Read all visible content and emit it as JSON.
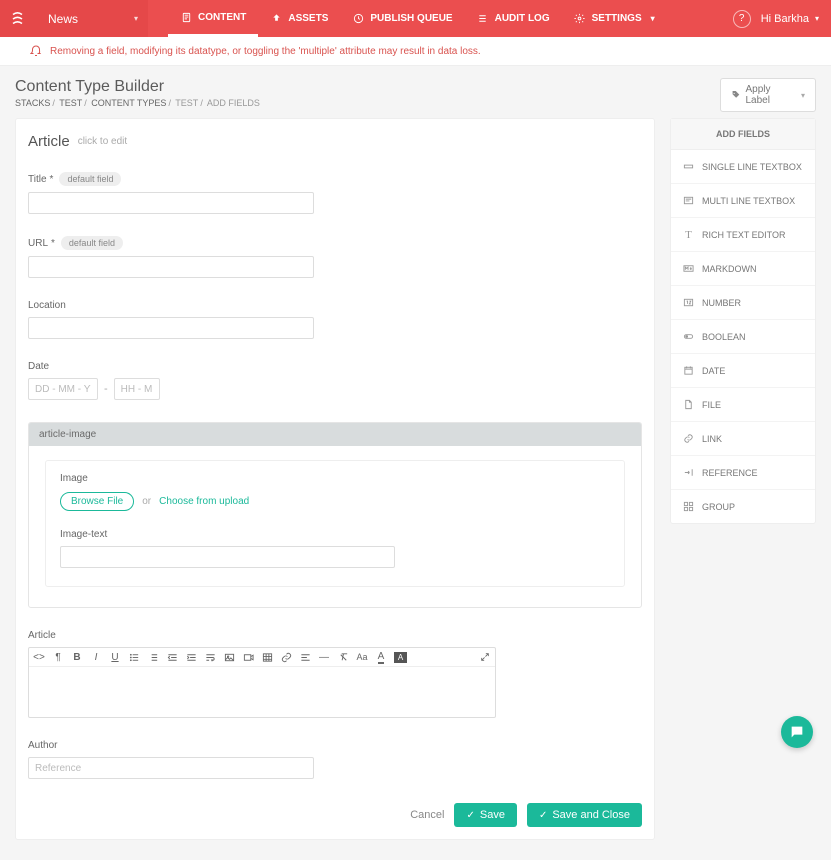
{
  "header": {
    "stack_name": "News",
    "nav": [
      {
        "label": "CONTENT",
        "active": true
      },
      {
        "label": "ASSETS",
        "active": false
      },
      {
        "label": "PUBLISH QUEUE",
        "active": false
      },
      {
        "label": "AUDIT LOG",
        "active": false
      },
      {
        "label": "SETTINGS",
        "active": false
      }
    ],
    "help_glyph": "?",
    "user_greeting": "Hi Barkha"
  },
  "warning": "Removing a field, modifying its datatype, or toggling the 'multiple' attribute may result in data loss.",
  "page": {
    "title": "Content Type Builder",
    "breadcrumb": [
      "STACKS",
      "TEST",
      "CONTENT TYPES",
      "TEST",
      "ADD FIELDS"
    ],
    "apply_label": "Apply Label"
  },
  "content_type": {
    "name": "Article",
    "hint": "click to edit"
  },
  "fields": {
    "title": {
      "label": "Title",
      "required_mark": "*",
      "pill": "default field"
    },
    "url": {
      "label": "URL",
      "required_mark": "*",
      "pill": "default field"
    },
    "location": {
      "label": "Location"
    },
    "date": {
      "label": "Date",
      "placeholder_date": "DD - MM - YYYY",
      "separator": "-",
      "placeholder_time": "HH - MM"
    },
    "group": {
      "header": "article-image",
      "image_label": "Image",
      "browse_button": "Browse File",
      "or_text": "or",
      "choose_link": "Choose from upload",
      "image_text_label": "Image-text"
    },
    "article": {
      "label": "Article"
    },
    "author": {
      "label": "Author",
      "placeholder": "Reference"
    }
  },
  "rte_tools": {
    "code": "code-icon",
    "para": "paragraph-icon",
    "bold": "B",
    "italic": "I",
    "underline": "U",
    "ul": "ul-icon",
    "ol": "ol-icon",
    "outdent": "outdent-icon",
    "indent": "indent-icon",
    "image": "image-icon",
    "video": "video-icon",
    "table": "table-icon",
    "link": "link-icon",
    "align": "align-icon",
    "hr": "—",
    "clear": "clear-icon",
    "aa": "Aa",
    "fontcolor": "A",
    "bg": "A",
    "expand": "expand-icon"
  },
  "sidebar": {
    "title": "ADD FIELDS",
    "items": [
      "SINGLE LINE TEXTBOX",
      "MULTI LINE TEXTBOX",
      "RICH TEXT EDITOR",
      "MARKDOWN",
      "NUMBER",
      "BOOLEAN",
      "DATE",
      "FILE",
      "LINK",
      "REFERENCE",
      "GROUP"
    ]
  },
  "footer": {
    "cancel": "Cancel",
    "save": "Save",
    "save_close": "Save and Close"
  }
}
